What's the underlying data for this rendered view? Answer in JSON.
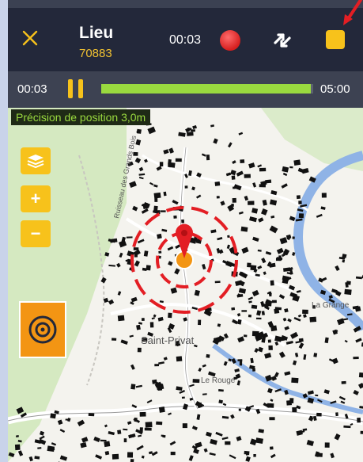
{
  "header": {
    "title": "Lieu",
    "subtitle": "70883",
    "timer": "00:03"
  },
  "player": {
    "elapsed": "00:03",
    "duration": "05:00",
    "progress_fraction": 0.99
  },
  "map": {
    "precision_label": "Précision de position 3,0m",
    "labels": {
      "village": "Saint-Privat",
      "le_rouge": "Le Rouge",
      "la_grange": "La Grange",
      "road": "Ruisseau des Grands Bois"
    },
    "zoom_in": "+",
    "zoom_out": "−"
  },
  "colors": {
    "accent": "#f7c21b",
    "record": "#d61f1f",
    "progress": "#9ada3f",
    "bar": "#23283a",
    "target_ring": "#e31e24",
    "river": "#7fa7e0",
    "forest": "#cfe6b8"
  },
  "icons": [
    "close-icon",
    "record-icon",
    "swap-icon",
    "stop-icon",
    "pause-icon",
    "layers-icon",
    "zoom-in-icon",
    "zoom-out-icon",
    "target-icon",
    "location-pin-icon"
  ]
}
